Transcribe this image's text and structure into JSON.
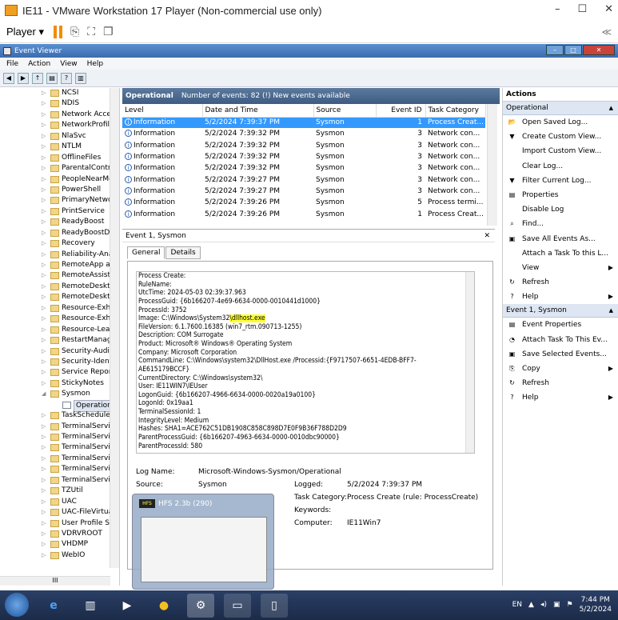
{
  "vm": {
    "title": "IE11 - VMware Workstation 17 Player (Non-commercial use only)",
    "player_label": "Player ▾",
    "minimize": "–",
    "maximize": "☐",
    "close": "✕",
    "collapse": "≪"
  },
  "app": {
    "title": "Event Viewer",
    "menu": [
      "File",
      "Action",
      "View",
      "Help"
    ]
  },
  "tree": {
    "items": [
      "NCSI",
      "NDIS",
      "Network Acces",
      "NetworkProfile",
      "NlaSvc",
      "NTLM",
      "OfflineFiles",
      "ParentalContro",
      "PeopleNearMe",
      "PowerShell",
      "PrimaryNetwo",
      "PrintService",
      "ReadyBoost",
      "ReadyBoostDri",
      "Recovery",
      "Reliability-Ana",
      "RemoteApp ar",
      "RemoteAssista",
      "RemoteDeskto",
      "RemoteDeskto",
      "Resource-Exha",
      "Resource-Exha",
      "Resource-Leak",
      "RestartManage",
      "Security-Audit",
      "Security-Identi",
      "Service Report",
      "StickyNotes",
      "Sysmon",
      "Operational",
      "TaskScheduler",
      "TerminalServic",
      "TerminalServic",
      "TerminalServic",
      "TerminalServic",
      "TerminalServic",
      "TerminalServic",
      "TZUtil",
      "UAC",
      "UAC-FileVirtua",
      "User Profile Se",
      "VDRVROOT",
      "VHDMP",
      "WebIO"
    ],
    "hscroll": "III"
  },
  "log": {
    "name": "Operational",
    "summary": "Number of events: 82 (!) New events available",
    "columns": [
      "Level",
      "Date and Time",
      "Source",
      "Event ID",
      "Task Category"
    ],
    "rows": [
      [
        "Information",
        "5/2/2024 7:39:37 PM",
        "Sysmon",
        "1",
        "Process Creat..."
      ],
      [
        "Information",
        "5/2/2024 7:39:32 PM",
        "Sysmon",
        "3",
        "Network con..."
      ],
      [
        "Information",
        "5/2/2024 7:39:32 PM",
        "Sysmon",
        "3",
        "Network con..."
      ],
      [
        "Information",
        "5/2/2024 7:39:32 PM",
        "Sysmon",
        "3",
        "Network con..."
      ],
      [
        "Information",
        "5/2/2024 7:39:32 PM",
        "Sysmon",
        "3",
        "Network con..."
      ],
      [
        "Information",
        "5/2/2024 7:39:27 PM",
        "Sysmon",
        "3",
        "Network con..."
      ],
      [
        "Information",
        "5/2/2024 7:39:27 PM",
        "Sysmon",
        "3",
        "Network con..."
      ],
      [
        "Information",
        "5/2/2024 7:39:26 PM",
        "Sysmon",
        "5",
        "Process termi..."
      ],
      [
        "Information",
        "5/2/2024 7:39:26 PM",
        "Sysmon",
        "1",
        "Process Creat..."
      ]
    ]
  },
  "detail": {
    "header": "Event 1, Sysmon",
    "close": "✕",
    "tabs": [
      "General",
      "Details"
    ],
    "lines_before": [
      "Process Create:",
      "RuleName:",
      "UtcTime: 2024-05-03 02:39:37.963",
      "ProcessGuid: {6b166207-4e69-6634-0000-0010441d1000}",
      "ProcessId: 3752"
    ],
    "image_prefix": "Image: C:\\Windows\\System32",
    "image_hl": "\\dllhost.exe",
    "lines_after": [
      "FileVersion: 6.1.7600.16385 (win7_rtm.090713-1255)",
      "Description: COM Surrogate",
      "Product: Microsoft® Windows® Operating System",
      "Company: Microsoft Corporation",
      "CommandLine: C:\\Windows\\system32\\DllHost.exe /Processid:{F9717507-6651-4EDB-BFF7-",
      "AE615179BCCF}",
      "CurrentDirectory: C:\\Windows\\system32\\",
      "User: IE11WIN7\\IEUser",
      "LogonGuid: {6b166207-4966-6634-0000-0020a19a0100}",
      "LogonId: 0x19aa1",
      "TerminalSessionId: 1",
      "IntegrityLevel: Medium",
      "Hashes: SHA1=ACE762C51DB1908C858C898D7E0F9B36F788D2D9",
      "ParentProcessGuid: {6b166207-4963-6634-0000-0010dbc90000}",
      "ParentProcessId: 580"
    ],
    "log_name_label": "Log Name:",
    "log_name": "Microsoft-Windows-Sysmon/Operational",
    "source_label": "Source:",
    "source": "Sysmon",
    "logged_label": "Logged:",
    "logged": "5/2/2024 7:39:37 PM",
    "task_label": "Task Category:",
    "task": "Process Create (rule: ProcessCreate)",
    "keywords_label": "Keywords:",
    "computer_label": "Computer:",
    "computer": "IE11Win7"
  },
  "actions": {
    "title": "Actions",
    "sections": [
      {
        "name": "Operational",
        "items": [
          {
            "label": "Open Saved Log...",
            "icon": "open-icon",
            "sub": false
          },
          {
            "label": "Create Custom View...",
            "icon": "filter-icon",
            "sub": false
          },
          {
            "label": "Import Custom View...",
            "icon": "",
            "sub": false
          },
          {
            "label": "Clear Log...",
            "icon": "",
            "sub": false
          },
          {
            "label": "Filter Current Log...",
            "icon": "filter-icon",
            "sub": false
          },
          {
            "label": "Properties",
            "icon": "properties-icon",
            "sub": false
          },
          {
            "label": "Disable Log",
            "icon": "",
            "sub": false
          },
          {
            "label": "Find...",
            "icon": "find-icon",
            "sub": false
          },
          {
            "label": "Save All Events As...",
            "icon": "save-icon",
            "sub": false
          },
          {
            "label": "Attach a Task To this L...",
            "icon": "",
            "sub": false
          },
          {
            "label": "View",
            "icon": "",
            "sub": true
          },
          {
            "label": "Refresh",
            "icon": "refresh-icon",
            "sub": false
          },
          {
            "label": "Help",
            "icon": "help-icon",
            "sub": true
          }
        ]
      },
      {
        "name": "Event 1, Sysmon",
        "items": [
          {
            "label": "Event Properties",
            "icon": "properties-icon",
            "sub": false
          },
          {
            "label": "Attach Task To This Ev...",
            "icon": "task-icon",
            "sub": false
          },
          {
            "label": "Save Selected Events...",
            "icon": "save-icon",
            "sub": false
          },
          {
            "label": "Copy",
            "icon": "copy-icon",
            "sub": true
          },
          {
            "label": "Refresh",
            "icon": "refresh-icon",
            "sub": false
          },
          {
            "label": "Help",
            "icon": "help-icon",
            "sub": true
          }
        ]
      }
    ]
  },
  "popup": {
    "title": "HFS 2.3b (290)",
    "badge": "HFS"
  },
  "taskbar": {
    "lang": "EN",
    "time": "7:44 PM",
    "date": "5/2/2024"
  }
}
